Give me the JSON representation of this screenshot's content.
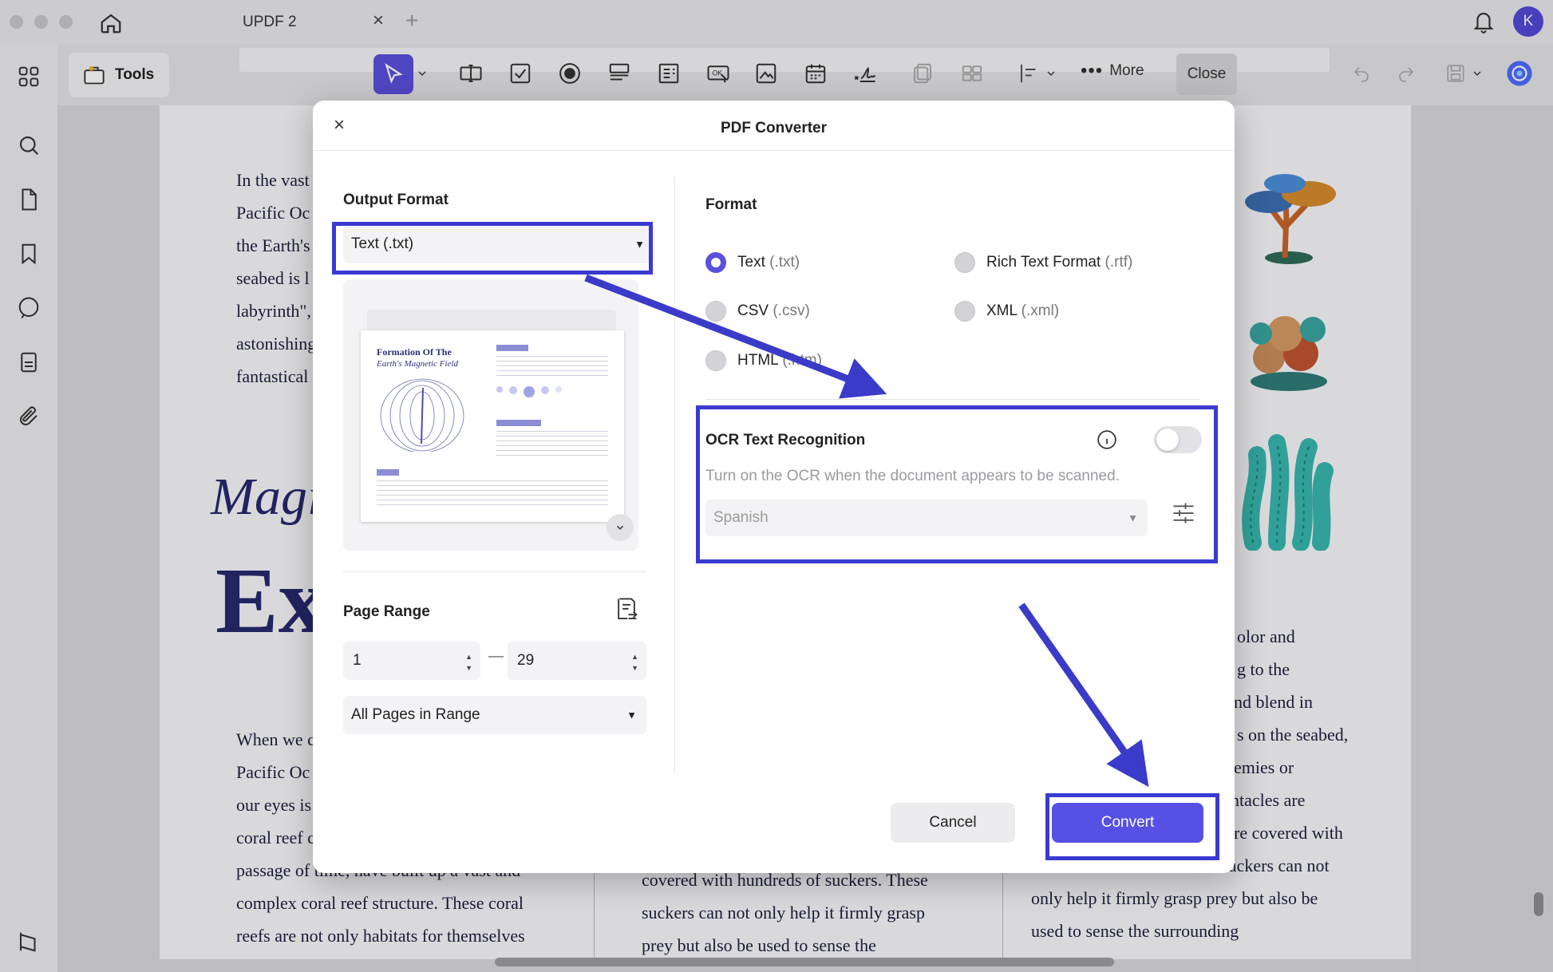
{
  "window": {
    "tab_title": "UPDF 2",
    "tab_close": "×",
    "tab_add": "+",
    "user_initial": "K"
  },
  "toolbar": {
    "tools_label": "Tools",
    "more_label": "More",
    "close_label": "Close"
  },
  "document": {
    "col1_top": [
      "In the vast",
      "Pacific Oc",
      "the Earth's",
      "seabed is l",
      "labyrinth\",",
      "astonishing",
      "fantastical"
    ],
    "heading_italic": "Magi",
    "heading_bold": "Ex",
    "col1_bottom": [
      "When we c",
      "Pacific Oc",
      "our eyes is",
      "coral reef c",
      "passage of time, have built up a vast and",
      "complex coral reef structure. These coral",
      "reefs are not only habitats for themselves"
    ],
    "col2_bottom": [
      "covered with hundreds of suckers. These",
      "suckers can not only help it firmly grasp",
      "prey but also be used to sense the"
    ],
    "col3": [
      "olor and",
      "g to the",
      "nd blend in",
      "s on the seabed,",
      "emies or",
      "ntacles are",
      "re covered with",
      "suckers can not",
      "only help it firmly grasp prey but also be",
      "used to sense the surrounding"
    ]
  },
  "dialog": {
    "title": "PDF Converter",
    "close_glyph": "×",
    "output_format_label": "Output Format",
    "output_format_value": "Text (.txt)",
    "preview": {
      "title": "Formation Of The",
      "subtitle": "Earth's Magnetic Field"
    },
    "page_range_label": "Page Range",
    "page_from": "1",
    "page_to": "29",
    "range_dash": "—",
    "range_mode": "All Pages in Range",
    "format_label": "Format",
    "formats": [
      {
        "name": "Text",
        "ext": "(.txt)",
        "selected": true
      },
      {
        "name": "Rich Text Format",
        "ext": "(.rtf)",
        "selected": false
      },
      {
        "name": "CSV",
        "ext": "(.csv)",
        "selected": false
      },
      {
        "name": "XML",
        "ext": "(.xml)",
        "selected": false
      },
      {
        "name": "HTML",
        "ext": "(.htm)",
        "selected": false
      }
    ],
    "ocr": {
      "title": "OCR Text Recognition",
      "description": "Turn on the OCR when the document appears to be scanned.",
      "language": "Spanish",
      "enabled": false
    },
    "cancel_label": "Cancel",
    "convert_label": "Convert"
  },
  "colors": {
    "accent": "#5650e4",
    "highlight_box": "#3a3ad1",
    "annotation_arrow": "#3b3bc9",
    "doc_text": "#1d1e3a"
  }
}
